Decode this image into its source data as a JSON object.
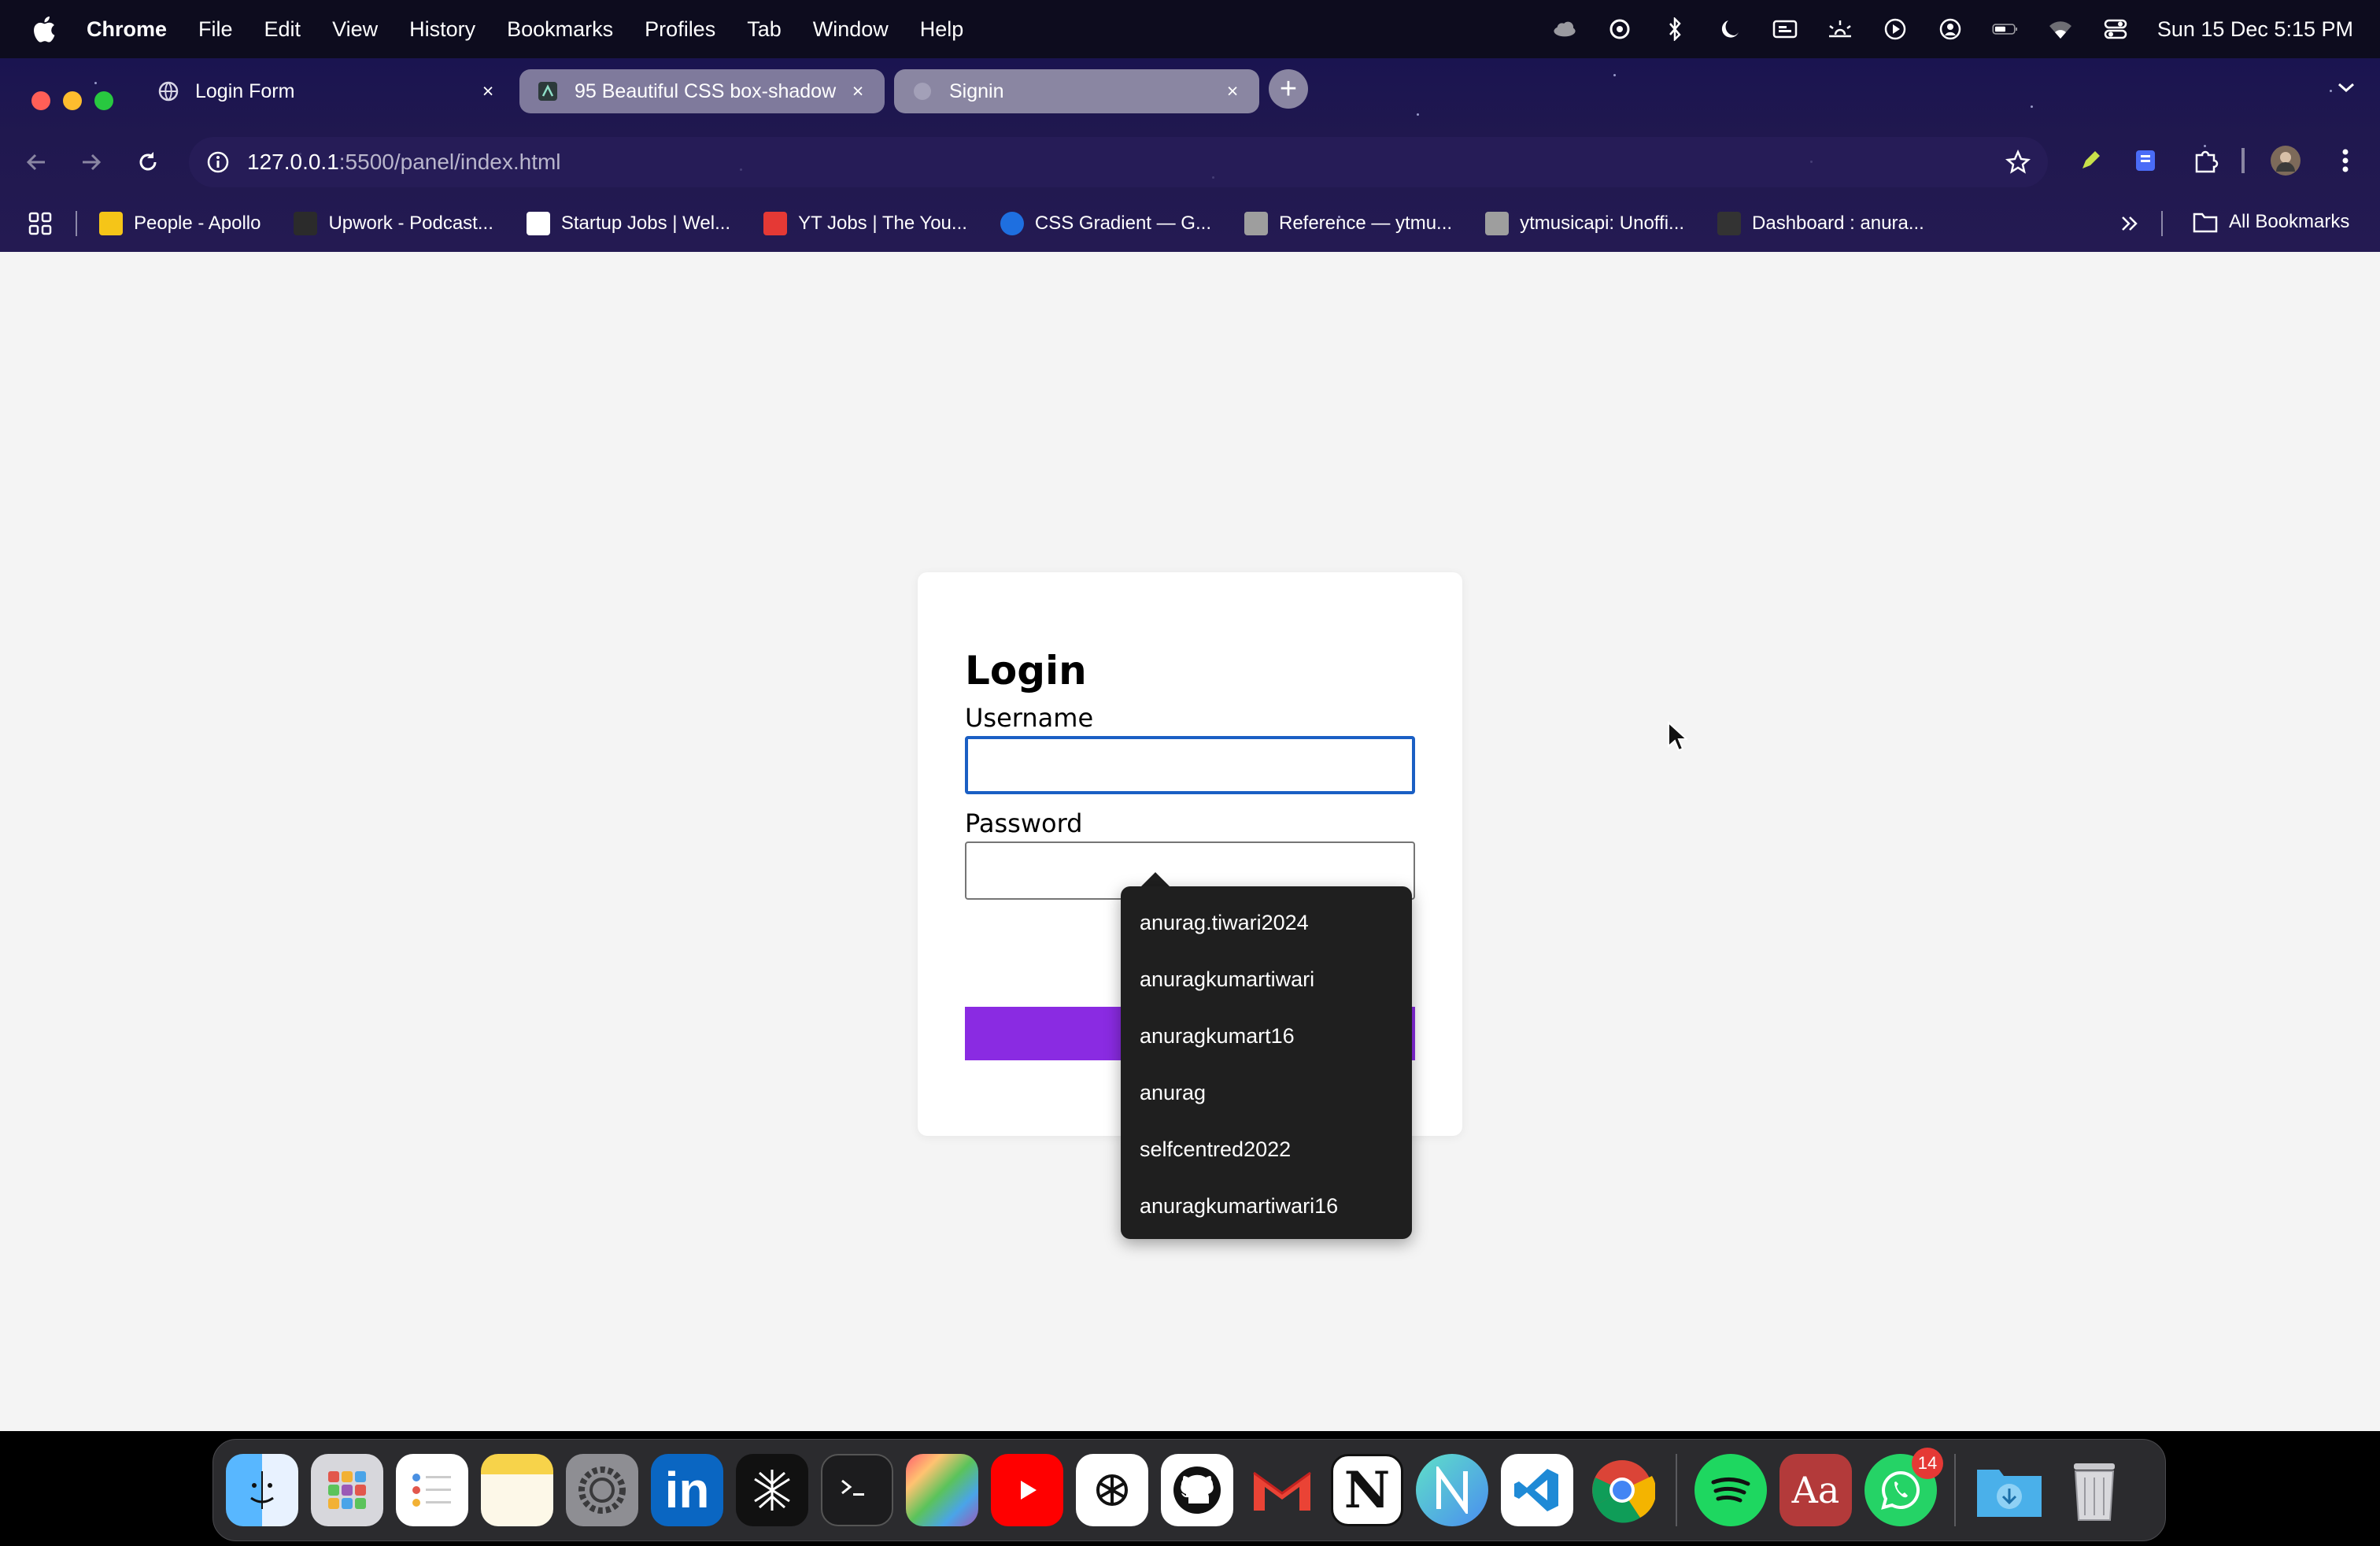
{
  "menubar": {
    "app_name": "Chrome",
    "items": [
      "File",
      "Edit",
      "View",
      "History",
      "Bookmarks",
      "Profiles",
      "Tab",
      "Window",
      "Help"
    ],
    "clock": "Sun 15 Dec  5:15 PM"
  },
  "tabs": [
    {
      "title": "Login Form",
      "close": "×"
    },
    {
      "title": "95 Beautiful CSS box-shadow",
      "close": "×"
    },
    {
      "title": "Signin",
      "close": "×"
    }
  ],
  "new_tab": "+",
  "address_bar": {
    "host": "127.0.0.1",
    "path": ":5500/panel/index.html"
  },
  "bookmarks": [
    {
      "label": "People - Apollo",
      "color": "#f5c518"
    },
    {
      "label": "Upwork - Podcast...",
      "color": "#2b2b2b"
    },
    {
      "label": "Startup Jobs | Wel...",
      "color": "#ffffff"
    },
    {
      "label": "YT Jobs | The You...",
      "color": "#e53935"
    },
    {
      "label": "CSS Gradient — G...",
      "color": "#1e6fe0"
    },
    {
      "label": "Reference — ytmu...",
      "color": "#9e9e9e"
    },
    {
      "label": "ytmusicapi: Unoffi...",
      "color": "#9e9e9e"
    },
    {
      "label": "Dashboard : anura...",
      "color": "#333333"
    }
  ],
  "all_bookmarks": "All Bookmarks",
  "login": {
    "title": "Login",
    "username_label": "Username",
    "username_value": "",
    "password_label": "Password",
    "password_value": "",
    "submit_label": ""
  },
  "autofill": [
    "anurag.tiwari2024",
    "anuragkumartiwari",
    "anuragkumart16",
    "anurag",
    "selfcentred2022",
    "anuragkumartiwari16"
  ],
  "dock": {
    "apps": [
      "Finder",
      "Launchpad",
      "Reminders",
      "Notes",
      "System Settings",
      "LinkedIn",
      "Perplexity",
      "Terminal",
      "Final Cut Pro",
      "YouTube",
      "ChatGPT",
      "GitHub",
      "Gmail",
      "Notion",
      "Notchmeister",
      "VS Code",
      "Chrome",
      "Spotify",
      "Dictionary",
      "WhatsApp",
      "Downloads",
      "Trash"
    ],
    "whatsapp_badge": "14",
    "linkedin_glyph": "in",
    "notion_glyph": "N",
    "dictionary_glyph": "Aa"
  },
  "colors": {
    "accent": "#8a2be2",
    "focus": "#1a5fc4",
    "page_bg": "#f4f4f4"
  }
}
